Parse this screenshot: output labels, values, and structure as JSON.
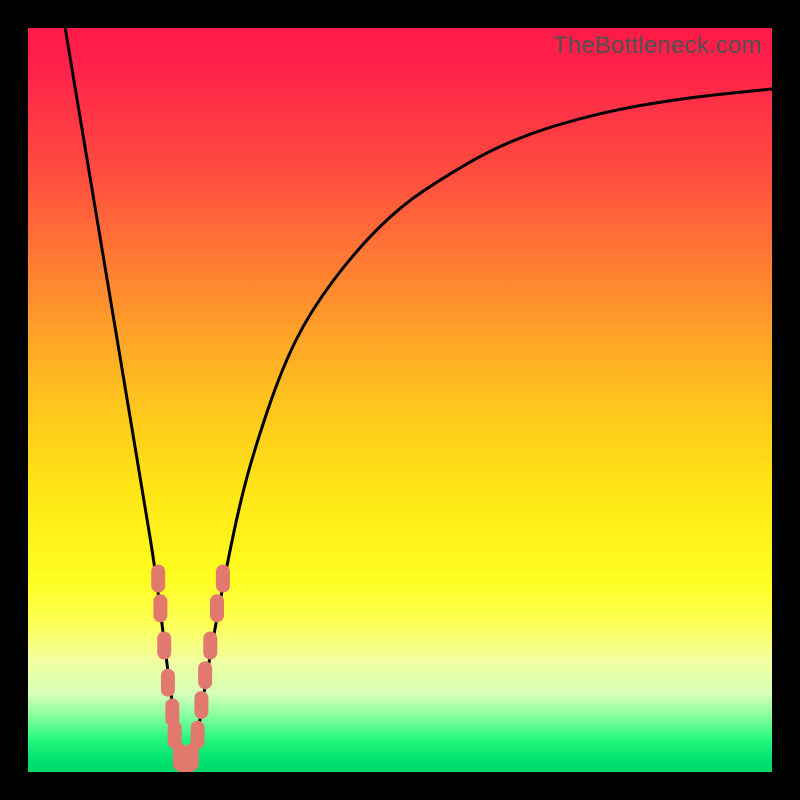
{
  "watermark": {
    "text": "TheBottleneck.com"
  },
  "gradient": {
    "stops": [
      {
        "offset": 0.0,
        "color": "#ff1a48"
      },
      {
        "offset": 0.06,
        "color": "#ff244a"
      },
      {
        "offset": 0.2,
        "color": "#ff4e3f"
      },
      {
        "offset": 0.35,
        "color": "#ff8a2f"
      },
      {
        "offset": 0.5,
        "color": "#ffc31e"
      },
      {
        "offset": 0.62,
        "color": "#ffe516"
      },
      {
        "offset": 0.74,
        "color": "#fffd20"
      },
      {
        "offset": 0.8,
        "color": "#fdff56"
      },
      {
        "offset": 0.85,
        "color": "#f2ffa0"
      },
      {
        "offset": 0.895,
        "color": "#d6ffb8"
      },
      {
        "offset": 0.925,
        "color": "#86ff9e"
      },
      {
        "offset": 0.955,
        "color": "#28f77e"
      },
      {
        "offset": 0.985,
        "color": "#00e270"
      },
      {
        "offset": 1.0,
        "color": "#00d868"
      }
    ]
  },
  "chart_data": {
    "type": "line",
    "title": "",
    "xlabel": "",
    "ylabel": "",
    "x_range": [
      0,
      100
    ],
    "y_range": [
      0,
      100
    ],
    "ylim": [
      0,
      100
    ],
    "series": [
      {
        "name": "bottleneck-curve",
        "x": [
          5,
          7,
          9,
          11,
          13,
          15,
          17,
          18,
          19,
          20,
          21,
          22,
          23,
          24,
          26,
          28,
          30,
          34,
          38,
          44,
          50,
          56,
          62,
          68,
          74,
          80,
          86,
          92,
          100
        ],
        "values": [
          100,
          88,
          76,
          64,
          52,
          40,
          28,
          20,
          12,
          5,
          1,
          1,
          6,
          13,
          24,
          34,
          42,
          54,
          62,
          70,
          76,
          80,
          83.5,
          86,
          87.8,
          89.2,
          90.2,
          91,
          91.8
        ]
      }
    ],
    "markers": [
      {
        "x": 17.5,
        "y": 26
      },
      {
        "x": 17.8,
        "y": 22
      },
      {
        "x": 18.3,
        "y": 17
      },
      {
        "x": 18.8,
        "y": 12
      },
      {
        "x": 19.4,
        "y": 8
      },
      {
        "x": 19.7,
        "y": 5
      },
      {
        "x": 20.4,
        "y": 2
      },
      {
        "x": 21.2,
        "y": 1
      },
      {
        "x": 22.0,
        "y": 2
      },
      {
        "x": 22.8,
        "y": 5
      },
      {
        "x": 23.3,
        "y": 9
      },
      {
        "x": 23.8,
        "y": 13
      },
      {
        "x": 24.5,
        "y": 17
      },
      {
        "x": 25.4,
        "y": 22
      },
      {
        "x": 26.2,
        "y": 26
      }
    ],
    "marker_color": "#e2796f",
    "curve_color": "#000000"
  }
}
